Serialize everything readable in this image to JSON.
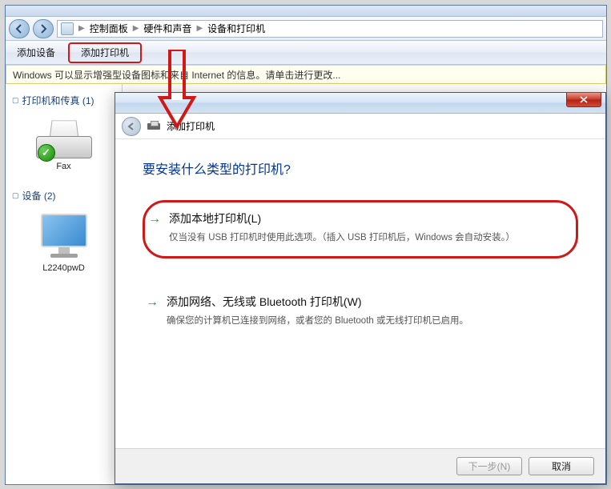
{
  "breadcrumb": {
    "root_icon_name": "computer-icon",
    "items": [
      "控制面板",
      "硬件和声音",
      "设备和打印机"
    ]
  },
  "toolbar": {
    "add_device": "添加设备",
    "add_printer": "添加打印机"
  },
  "infobar": {
    "text": "Windows 可以显示增强型设备图标和来自 Internet 的信息。请单击进行更改..."
  },
  "sidebar": {
    "group1": {
      "title": "打印机和传真 (1)"
    },
    "group2": {
      "title": "设备 (2)"
    },
    "fax_label": "Fax",
    "monitor_label": "L2240pwD"
  },
  "dialog": {
    "header_title": "添加打印机",
    "question": "要安装什么类型的打印机?",
    "opt1_title": "添加本地打印机(L)",
    "opt1_desc": "仅当没有 USB 打印机时使用此选项。（插入 USB 打印机后，Windows 会自动安装。）",
    "opt2_title": "添加网络、无线或 Bluetooth 打印机(W)",
    "opt2_desc": "确保您的计算机已连接到网络，或者您的 Bluetooth 或无线打印机已启用。",
    "next_btn": "下一步(N)",
    "cancel_btn": "取消"
  }
}
